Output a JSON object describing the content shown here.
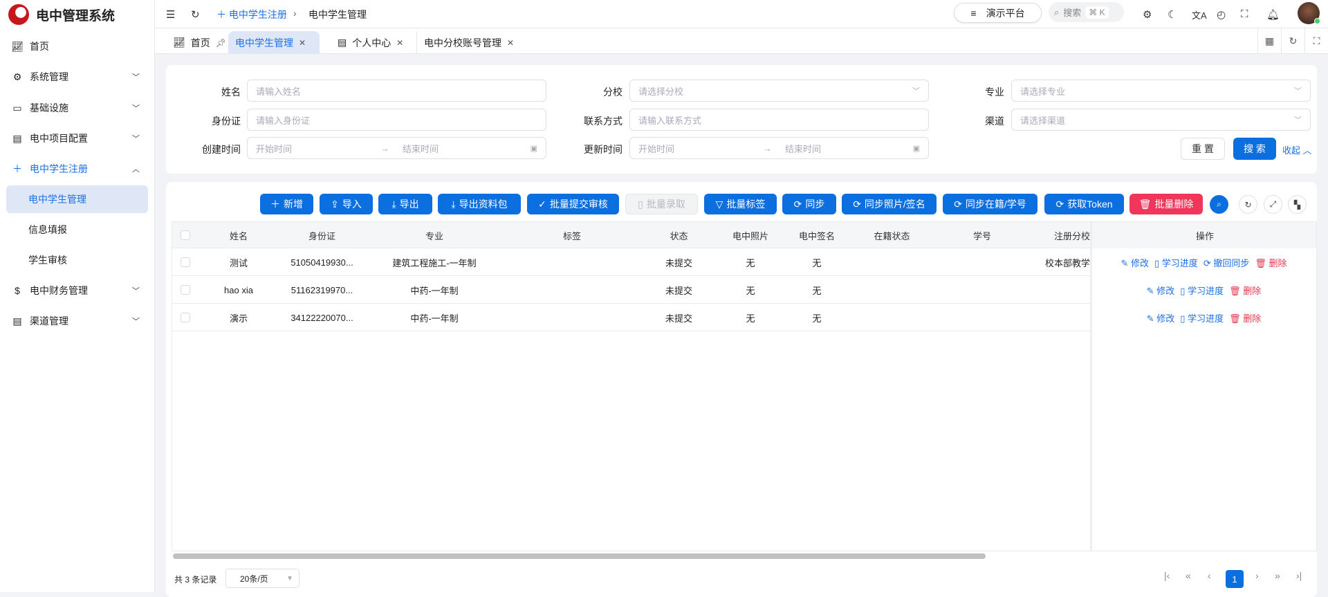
{
  "app": {
    "title": "电中管理系统"
  },
  "sidebar": {
    "items": [
      {
        "label": "首页",
        "icon": "chart-icon"
      },
      {
        "label": "系统管理",
        "icon": "gear-icon"
      },
      {
        "label": "基础设施",
        "icon": "monitor-icon"
      },
      {
        "label": "电中项目配置",
        "icon": "document-icon"
      },
      {
        "label": "电中学生注册",
        "icon": "plus-icon"
      },
      {
        "label": "电中学生管理"
      },
      {
        "label": "信息填报"
      },
      {
        "label": "学生审核"
      },
      {
        "label": "电中财务管理",
        "icon": "dollar-icon"
      },
      {
        "label": "渠道管理",
        "icon": "document-icon"
      }
    ]
  },
  "header": {
    "breadcrumb": [
      "电中学生注册",
      "电中学生管理"
    ],
    "platform": "演示平台",
    "search": "搜索",
    "shortcut": "⌘ K"
  },
  "tabs": [
    {
      "label": "首页"
    },
    {
      "label": "电中学生管理"
    },
    {
      "label": "个人中心"
    },
    {
      "label": "电中分校账号管理"
    }
  ],
  "filters": {
    "name": {
      "label": "姓名",
      "placeholder": "请输入姓名"
    },
    "branch": {
      "label": "分校",
      "placeholder": "请选择分校"
    },
    "major": {
      "label": "专业",
      "placeholder": "请选择专业"
    },
    "idcard": {
      "label": "身份证",
      "placeholder": "请输入身份证"
    },
    "contact": {
      "label": "联系方式",
      "placeholder": "请输入联系方式"
    },
    "channel": {
      "label": "渠道",
      "placeholder": "请选择渠道"
    },
    "created": {
      "label": "创建时间",
      "start": "开始时间",
      "end": "结束时间"
    },
    "updated": {
      "label": "更新时间",
      "start": "开始时间",
      "end": "结束时间"
    },
    "reset": "重 置",
    "search": "搜 索",
    "collapse": "收起"
  },
  "toolbar": [
    "新增",
    "导入",
    "导出",
    "导出资料包",
    "批量提交审核",
    "批量录取",
    "批量标签",
    "同步",
    "同步照片/签名",
    "同步在籍/学号",
    "获取Token",
    "批量删除"
  ],
  "table": {
    "columns": [
      "姓名",
      "身份证",
      "专业",
      "标签",
      "状态",
      "电中照片",
      "电中签名",
      "在籍状态",
      "学号",
      "注册分校",
      "操作"
    ],
    "rows": [
      {
        "name": "测试",
        "id": "51050419930...",
        "major": "建筑工程施工-一年制",
        "tag": "",
        "status": "未提交",
        "photo": "无",
        "sign": "无",
        "enroll": "",
        "sno": "",
        "branch": "校本部教学",
        "actions": [
          "修改",
          "学习进度",
          "撤回同步",
          "删除"
        ]
      },
      {
        "name": "hao xia",
        "id": "51162319970...",
        "major": "中药-一年制",
        "tag": "",
        "status": "未提交",
        "photo": "无",
        "sign": "无",
        "enroll": "",
        "sno": "",
        "branch": "",
        "actions": [
          "修改",
          "学习进度",
          "删除"
        ]
      },
      {
        "name": "演示",
        "id": "34122220070...",
        "major": "中药-一年制",
        "tag": "",
        "status": "未提交",
        "photo": "无",
        "sign": "无",
        "enroll": "",
        "sno": "",
        "branch": "",
        "actions": [
          "修改",
          "学习进度",
          "删除"
        ]
      }
    ]
  },
  "pagination": {
    "total": "共 3 条记录",
    "page_size": "20条/页",
    "current": "1"
  }
}
